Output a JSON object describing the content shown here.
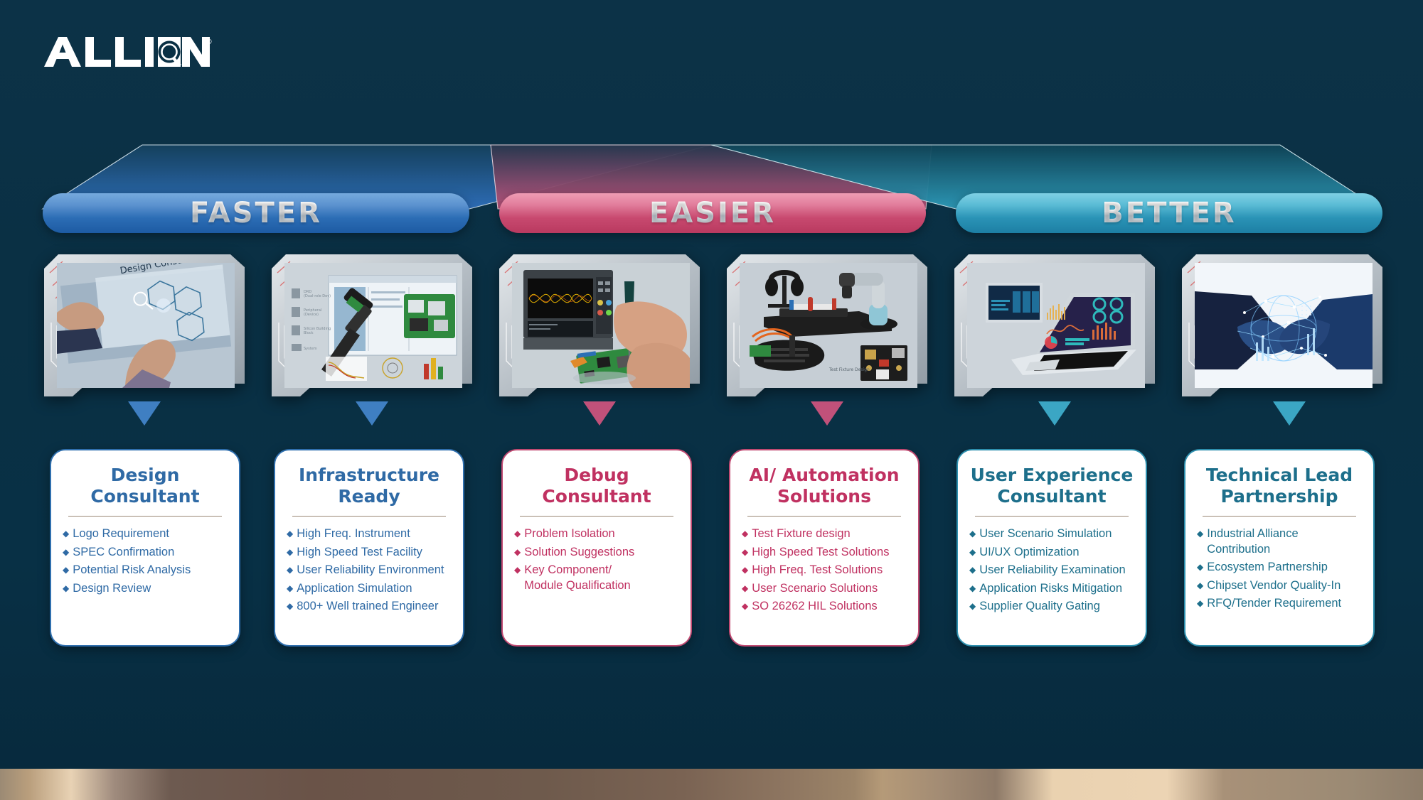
{
  "brand": {
    "logo_text": "ALLION",
    "logo_mark": "magnifier-icon",
    "registered_mark": "®"
  },
  "banners": [
    {
      "label": "FASTER",
      "color": "#2c6db5",
      "name": "faster"
    },
    {
      "label": "EASIER",
      "color": "#c8496f",
      "name": "easier"
    },
    {
      "label": "BETTER",
      "color": "#2a93b6",
      "name": "better"
    }
  ],
  "photos": [
    {
      "caption": "Design Consultant",
      "alt": "hands-touching-holographic-design-panel"
    },
    {
      "caption": "",
      "alt": "usb-c-connector-pcb-and-analysis-software"
    },
    {
      "caption": "",
      "alt": "oscilloscope-eye-diagram-with-probing-hands"
    },
    {
      "caption": "Test Fixture Design",
      "alt": "robotic-arm-test-fixture-with-headset-and-keyboard"
    },
    {
      "caption": "",
      "alt": "laptop-and-monitor-showing-analytics-dashboard"
    },
    {
      "caption": "",
      "alt": "handshake-with-digital-network-globe"
    }
  ],
  "cards": [
    {
      "title": "Design\nConsultant",
      "title_lines": [
        "Design",
        "Consultant"
      ],
      "theme": "blue",
      "items": [
        "Logo Requirement",
        "SPEC Confirmation",
        "Potential Risk Analysis",
        "Design Review"
      ]
    },
    {
      "title": "Infrastructure\nReady",
      "title_lines": [
        "Infrastructure",
        "Ready"
      ],
      "theme": "blue",
      "items": [
        "High Freq. Instrument",
        "High Speed Test Facility",
        "User Reliability Environment",
        "Application Simulation",
        "800+ Well trained Engineer"
      ]
    },
    {
      "title": "Debug\nConsultant",
      "title_lines": [
        "Debug",
        "Consultant"
      ],
      "theme": "pink",
      "items": [
        "Problem Isolation",
        "Solution Suggestions",
        "Key Component/\nModule Qualification"
      ]
    },
    {
      "title": "AI/ Automation\nSolutions",
      "title_lines": [
        "AI/ Automation",
        "Solutions"
      ],
      "theme": "pink",
      "items": [
        "Test Fixture design",
        "High Speed Test Solutions",
        "High Freq. Test Solutions",
        "User Scenario Solutions",
        "SO 26262 HIL Solutions"
      ]
    },
    {
      "title": "User Experience\nConsultant",
      "title_lines": [
        "User Experience",
        "Consultant"
      ],
      "theme": "teal",
      "items": [
        "User Scenario Simulation",
        "UI/UX Optimization",
        "User Reliability Examination",
        "Application Risks Mitigation",
        "Supplier Quality Gating"
      ]
    },
    {
      "title": "Technical Lead\nPartnership",
      "title_lines": [
        "Technical Lead",
        "Partnership"
      ],
      "theme": "teal",
      "items": [
        "Industrial Alliance\nContribution",
        "Ecosystem Partnership",
        "Chipset Vendor Quality-In",
        "RFQ/Tender Requirement"
      ]
    }
  ],
  "bullet_glyph": "◆",
  "colors": {
    "background": "#0a3044",
    "blue": "#2f6aa5",
    "pink": "#c03161",
    "teal": "#1d6f8b",
    "divider": "#9a8874"
  }
}
